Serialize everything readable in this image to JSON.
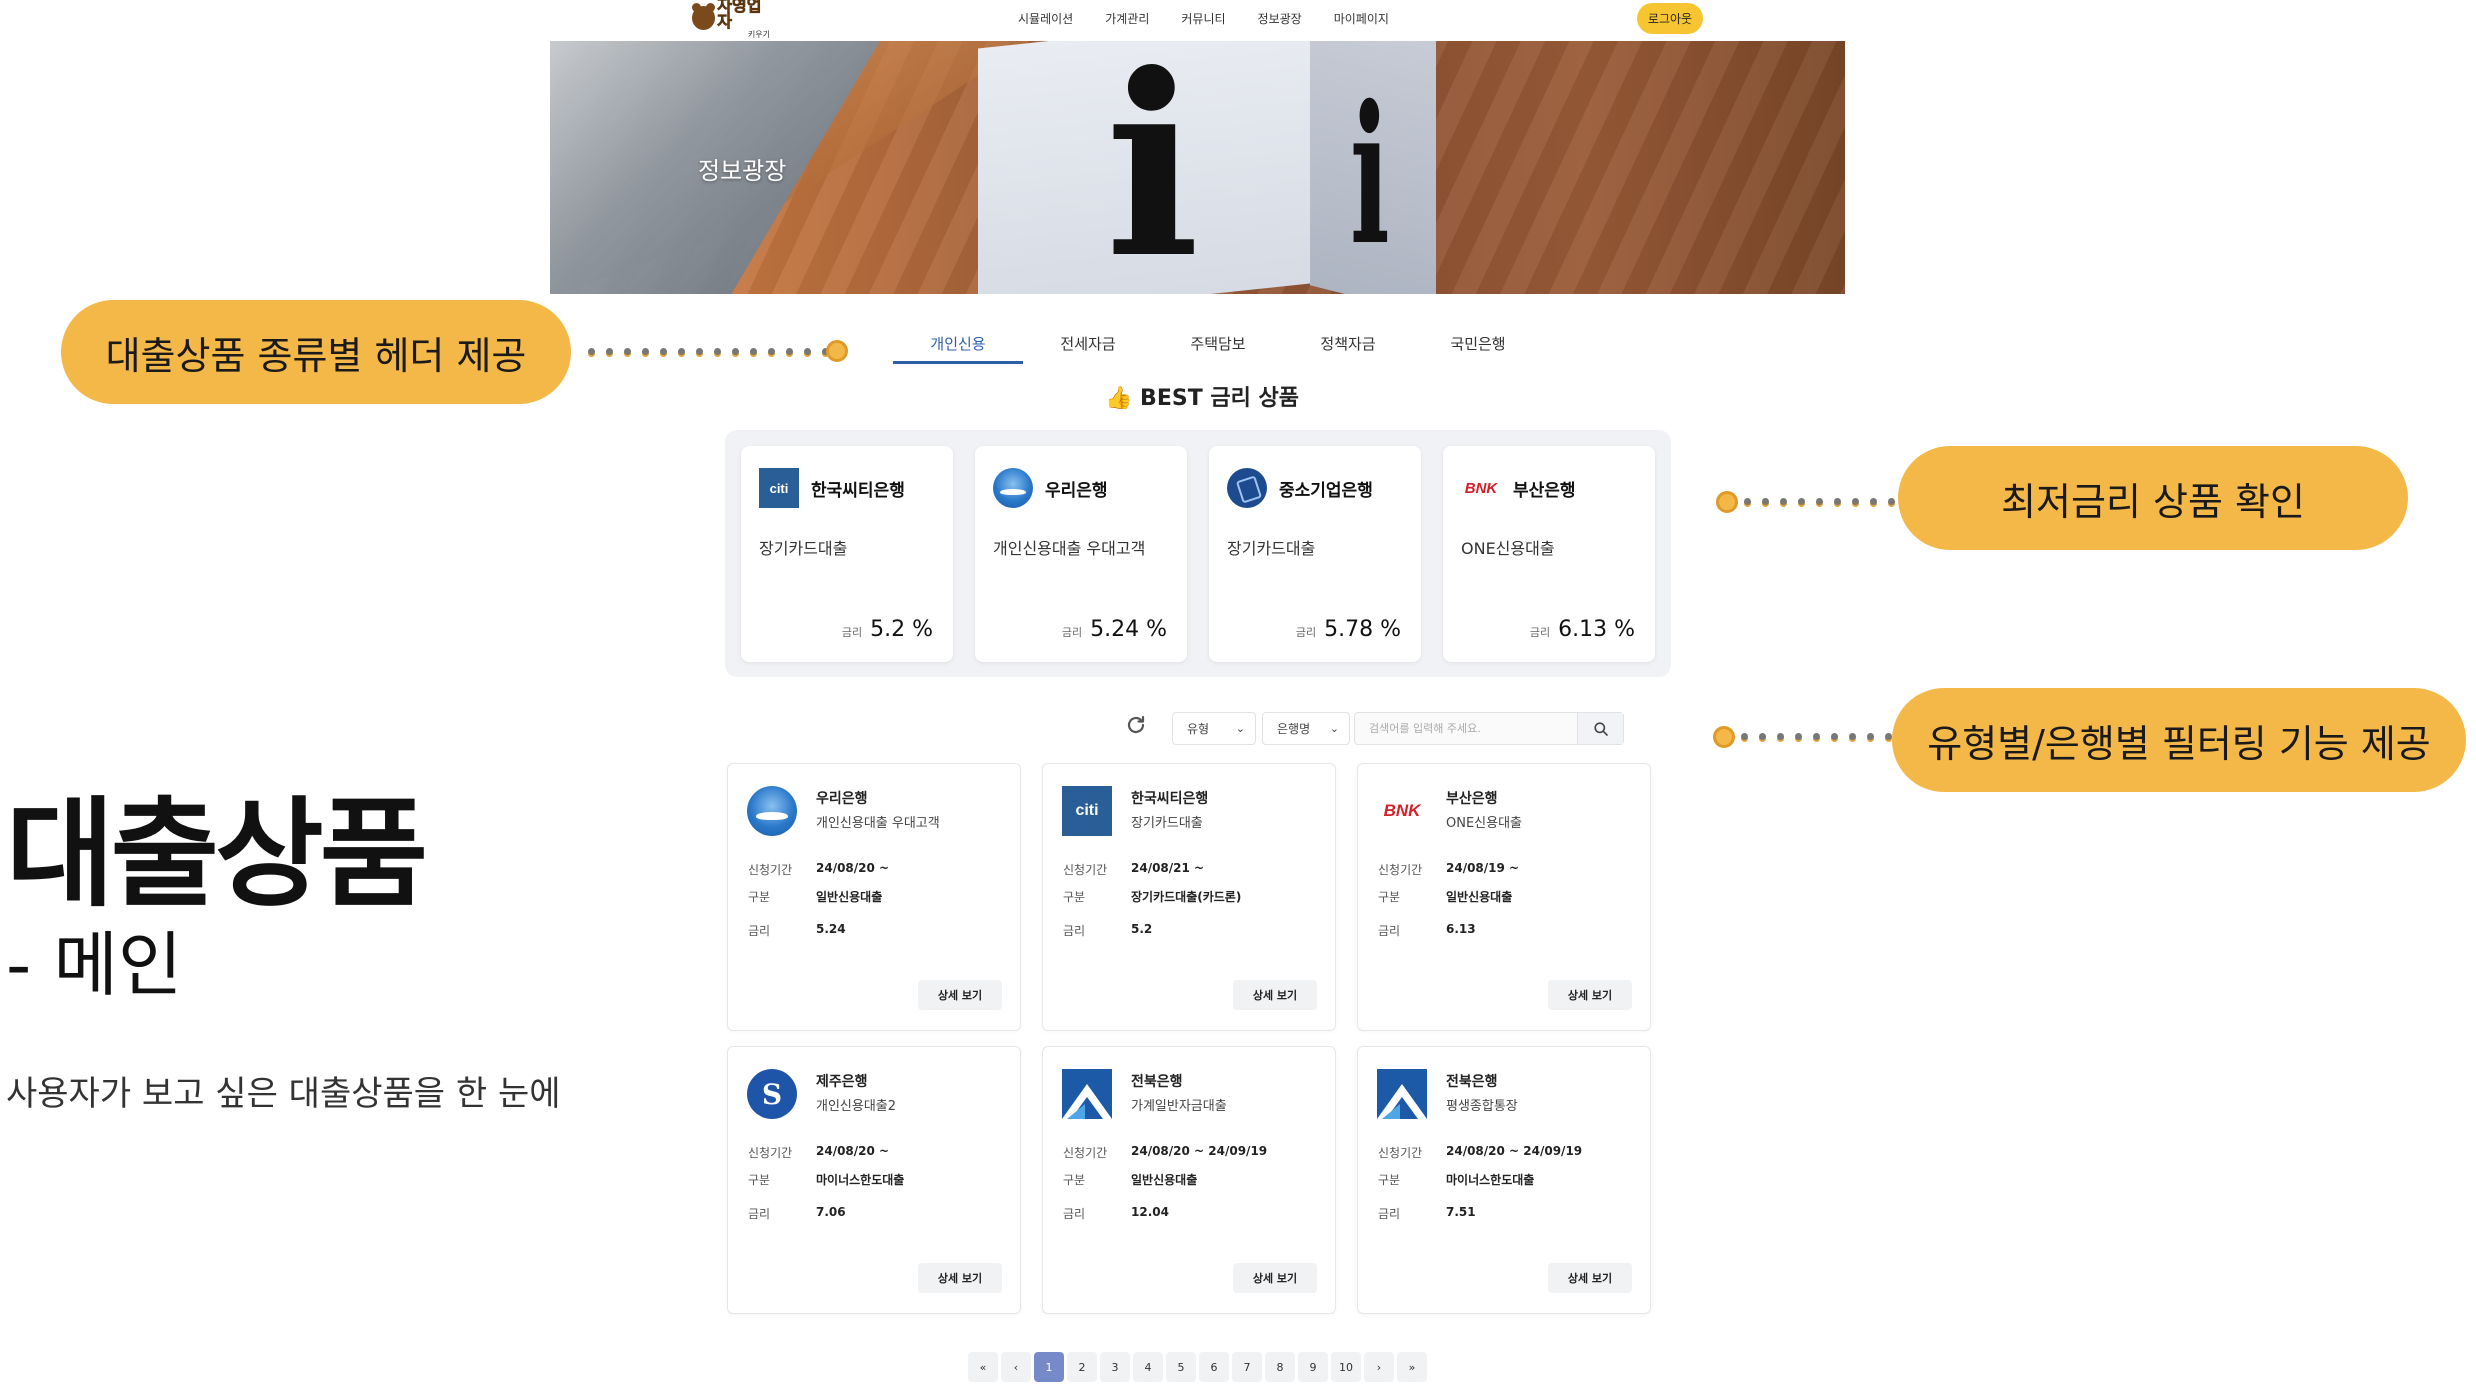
{
  "slide": {
    "title": "대출상품",
    "subtitle": "- 메인",
    "description": "사용자가 보고 싶은 대출상품을 한 눈에"
  },
  "callouts": {
    "tabs": "대출상품 종류별 헤더 제공",
    "best": "최저금리 상품 확인",
    "filter": "유형별/은행별 필터링 기능 제공"
  },
  "navbar": {
    "logo_main": "자영업자",
    "logo_sub": "키우기",
    "items": [
      "시뮬레이션",
      "가계관리",
      "커뮤니티",
      "정보광장",
      "마이페이지"
    ],
    "logout": "로그아웃"
  },
  "banner": {
    "title": "정보광장",
    "glyph": "i"
  },
  "tabs": [
    "개인신용",
    "전세자금",
    "주택담보",
    "정책자금",
    "국민은행"
  ],
  "best": {
    "title": "👍 BEST 금리 상품",
    "rate_label": "금리",
    "cards": [
      {
        "bank": "한국씨티은행",
        "product": "장기카드대출",
        "rate": "5.2 %",
        "logo": "citi-logo-icon",
        "logo_text": "citi"
      },
      {
        "bank": "우리은행",
        "product": "개인신용대출 우대고객",
        "rate": "5.24 %",
        "logo": "woori-logo-icon",
        "logo_text": ""
      },
      {
        "bank": "중소기업은행",
        "product": "장기카드대출",
        "rate": "5.78 %",
        "logo": "ibk-logo-icon",
        "logo_text": ""
      },
      {
        "bank": "부산은행",
        "product": "ONE신용대출",
        "rate": "6.13 %",
        "logo": "bnk-logo-icon",
        "logo_text": "BNK"
      }
    ]
  },
  "filter": {
    "type_select": "유형",
    "bank_select": "은행명",
    "search_placeholder": "검색어를 입력해 주세요."
  },
  "products": {
    "labels": {
      "period": "신청기간",
      "category": "구분",
      "rate": "금리",
      "detail": "상세 보기"
    },
    "items": [
      {
        "bank": "우리은행",
        "product": "개인신용대출 우대고객",
        "period": "24/08/20 ~",
        "category": "일반신용대출",
        "rate": "5.24",
        "logo": "woori-logo-icon",
        "logo_text": ""
      },
      {
        "bank": "한국씨티은행",
        "product": "장기카드대출",
        "period": "24/08/21 ~",
        "category": "장기카드대출(카드론)",
        "rate": "5.2",
        "logo": "citi-logo-icon",
        "logo_text": "citi"
      },
      {
        "bank": "부산은행",
        "product": "ONE신용대출",
        "period": "24/08/19 ~",
        "category": "일반신용대출",
        "rate": "6.13",
        "logo": "bnk-logo-icon",
        "logo_text": "BNK"
      },
      {
        "bank": "제주은행",
        "product": "개인신용대출2",
        "period": "24/08/20 ~",
        "category": "마이너스한도대출",
        "rate": "7.06",
        "logo": "jeju-logo-icon",
        "logo_text": "S"
      },
      {
        "bank": "전북은행",
        "product": "가계일반자금대출",
        "period": "24/08/20 ~ 24/09/19",
        "category": "일반신용대출",
        "rate": "12.04",
        "logo": "jb-logo-icon",
        "logo_text": ""
      },
      {
        "bank": "전북은행",
        "product": "평생종합통장",
        "period": "24/08/20 ~ 24/09/19",
        "category": "마이너스한도대출",
        "rate": "7.51",
        "logo": "jb-logo-icon",
        "logo_text": ""
      }
    ]
  },
  "pagination": {
    "first": "«",
    "prev": "‹",
    "pages": [
      "1",
      "2",
      "3",
      "4",
      "5",
      "6",
      "7",
      "8",
      "9",
      "10"
    ],
    "current": "1",
    "next": "›",
    "last": "»"
  },
  "colors": {
    "accent": "#f4b848",
    "tab_active": "#2f5fa8",
    "page_active": "#7689c9",
    "logout": "#f7c531"
  }
}
